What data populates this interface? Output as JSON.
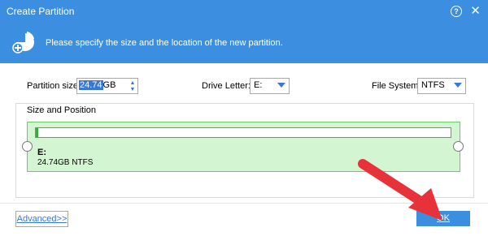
{
  "window": {
    "title": "Create Partition",
    "help_glyph": "?",
    "close_glyph": "✕"
  },
  "banner": {
    "text": "Please specify the size and the location of the new partition."
  },
  "fields": {
    "size_label": "Partition size:",
    "size_value_selected": "24.74",
    "size_unit": "GB",
    "drive_label": "Drive Letter:",
    "drive_value": "E:",
    "fs_label": "File System:",
    "fs_value": "NTFS"
  },
  "group": {
    "title": "Size and Position",
    "partition_letter": "E:",
    "partition_info": "24.74GB NTFS"
  },
  "buttons": {
    "advanced_label": "Advanced>>",
    "ok_label": "OK"
  },
  "colors": {
    "accent": "#3c8fe0",
    "partition_fill": "#d4f5d2",
    "partition_border": "#6fc76b",
    "arrow": "#e8323a"
  },
  "icons": {
    "banner": "add-partition-icon",
    "spin": "spin-arrows-icon",
    "combo": "chevron-down-icon",
    "pointer": "red-arrow-icon"
  }
}
